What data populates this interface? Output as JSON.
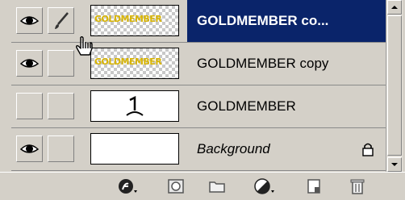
{
  "layers": [
    {
      "name": "GOLDMEMBER co...",
      "selected": true,
      "visible": true,
      "brush": true,
      "thumb": "gold-text",
      "thumb_text": "GOLDMEMBER"
    },
    {
      "name": "GOLDMEMBER copy",
      "selected": false,
      "visible": true,
      "brush": false,
      "thumb": "gold-text",
      "thumb_text": "GOLDMEMBER"
    },
    {
      "name": "GOLDMEMBER",
      "selected": false,
      "visible": false,
      "brush": false,
      "thumb": "text-layer-icon"
    },
    {
      "name": "Background",
      "selected": false,
      "visible": true,
      "brush": false,
      "thumb": "white",
      "locked": true
    }
  ],
  "toolbar": [
    "layer-style-icon",
    "add-mask-icon",
    "new-group-icon",
    "adjustment-layer-icon",
    "new-layer-icon",
    "trash-icon"
  ],
  "colors": {
    "selection": "#0a246a",
    "panel": "#d4d0c8",
    "gold": "#d8b400"
  }
}
